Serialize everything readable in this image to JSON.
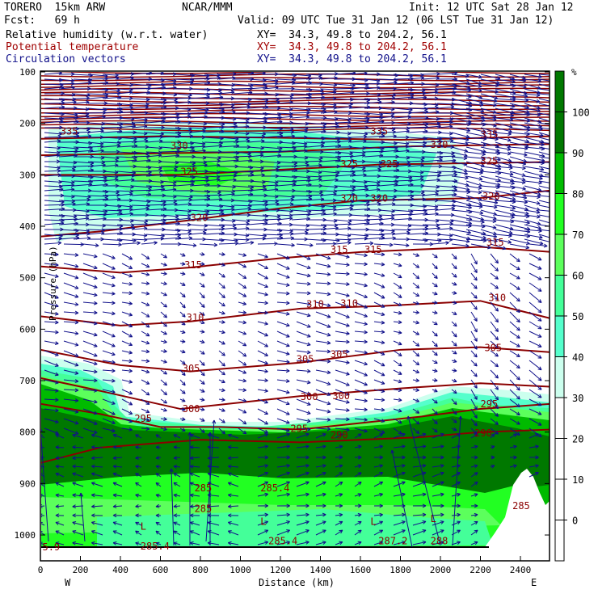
{
  "header": {
    "model": "TORERO  15km ARW",
    "org": "NCAR/MMM",
    "init": "Init: 12 UTC Sat 28 Jan 12",
    "fcst": "Fcst:   69 h",
    "valid": "Valid: 09 UTC Tue 31 Jan 12 (06 LST Tue 31 Jan 12)",
    "fields": [
      {
        "name": "Relative humidity (w.r.t. water)",
        "xy": "XY=  34.3, 49.8 to 204.2, 56.1",
        "color": "#000000"
      },
      {
        "name": "Potential temperature",
        "xy": "XY=  34.3, 49.8 to 204.2, 56.1",
        "color": "#a00000"
      },
      {
        "name": "Circulation vectors",
        "xy": "XY=  34.3, 49.8 to 204.2, 56.1",
        "color": "#10108a"
      }
    ]
  },
  "chart_data": {
    "type": "heatmap",
    "title": "Cross section: relative humidity, potential temperature, circulation vectors",
    "xlabel": "Distance (km)",
    "ylabel": "Pressure (hPa)",
    "x_ticks": [
      0,
      200,
      400,
      600,
      800,
      1000,
      1200,
      1400,
      1600,
      1800,
      2000,
      2200,
      2400
    ],
    "y_ticks": [
      100,
      200,
      300,
      400,
      500,
      600,
      700,
      800,
      900,
      1000
    ],
    "xlim": [
      0,
      2560
    ],
    "ylim": [
      1050,
      100
    ],
    "x_end_labels": {
      "left": "W",
      "right": "E"
    },
    "colorbar": {
      "unit": "%",
      "ticks": [
        100,
        90,
        80,
        70,
        60,
        50,
        40,
        30,
        20,
        10,
        0
      ],
      "levels": [
        {
          "range": ">100",
          "color": "#007800"
        },
        {
          "range": "90-100",
          "color": "#007800"
        },
        {
          "range": "80-90",
          "color": "#00bb00"
        },
        {
          "range": "70-80",
          "color": "#22ff22"
        },
        {
          "range": "60-70",
          "color": "#5cff5c"
        },
        {
          "range": "50-60",
          "color": "#44ff99"
        },
        {
          "range": "40-50",
          "color": "#55ffcc"
        },
        {
          "range": "30-40",
          "color": "#ccffee"
        },
        {
          "range": "20-30",
          "color": "#ffffff"
        },
        {
          "range": "10-20",
          "color": "#ffffff"
        },
        {
          "range": "0-10",
          "color": "#ffffff"
        },
        {
          "range": "<0",
          "color": "#ffffff"
        }
      ]
    },
    "theta_contours": [
      {
        "value": 335,
        "points": [
          [
            0,
            230
          ],
          [
            600,
            225
          ],
          [
            1200,
            228
          ],
          [
            1800,
            232
          ],
          [
            2560,
            225
          ]
        ]
      },
      {
        "value": 330,
        "points": [
          [
            0,
            262
          ],
          [
            600,
            258
          ],
          [
            1200,
            255
          ],
          [
            1800,
            245
          ],
          [
            2560,
            240
          ]
        ]
      },
      {
        "value": 325,
        "points": [
          [
            0,
            300
          ],
          [
            700,
            300
          ],
          [
            1200,
            290
          ],
          [
            1700,
            280
          ],
          [
            2560,
            275
          ]
        ]
      },
      {
        "value": 320,
        "points": [
          [
            0,
            420
          ],
          [
            300,
            410
          ],
          [
            750,
            388
          ],
          [
            1200,
            365
          ],
          [
            1600,
            350
          ],
          [
            2200,
            345
          ],
          [
            2560,
            330
          ]
        ]
      },
      {
        "value": 315,
        "points": [
          [
            0,
            478
          ],
          [
            400,
            490
          ],
          [
            750,
            480
          ],
          [
            1200,
            462
          ],
          [
            1600,
            450
          ],
          [
            2200,
            440
          ],
          [
            2560,
            450
          ]
        ]
      },
      {
        "value": 310,
        "points": [
          [
            0,
            575
          ],
          [
            400,
            593
          ],
          [
            750,
            585
          ],
          [
            1300,
            560
          ],
          [
            1700,
            555
          ],
          [
            2200,
            545
          ],
          [
            2560,
            580
          ]
        ]
      },
      {
        "value": 305,
        "points": [
          [
            0,
            640
          ],
          [
            400,
            670
          ],
          [
            750,
            682
          ],
          [
            1300,
            665
          ],
          [
            1800,
            640
          ],
          [
            2200,
            635
          ],
          [
            2560,
            645
          ]
        ]
      },
      {
        "value": 300,
        "points": [
          [
            0,
            695
          ],
          [
            300,
            720
          ],
          [
            700,
            755
          ],
          [
            1300,
            730
          ],
          [
            1800,
            715
          ],
          [
            2200,
            705
          ],
          [
            2560,
            712
          ]
        ]
      },
      {
        "value": 295,
        "points": [
          [
            0,
            745
          ],
          [
            300,
            765
          ],
          [
            600,
            790
          ],
          [
            900,
            790
          ],
          [
            1300,
            795
          ],
          [
            1900,
            770
          ],
          [
            2200,
            755
          ],
          [
            2560,
            745
          ]
        ]
      },
      {
        "value": 290,
        "points": [
          [
            0,
            860
          ],
          [
            300,
            830
          ],
          [
            800,
            815
          ],
          [
            1300,
            820
          ],
          [
            1900,
            810
          ],
          [
            2200,
            800
          ],
          [
            2560,
            795
          ]
        ]
      }
    ],
    "contour_labels": [
      {
        "text": "335",
        "km": 100,
        "hPa": 222
      },
      {
        "text": "335",
        "km": 1650,
        "hPa": 222
      },
      {
        "text": "335",
        "km": 2200,
        "hPa": 228
      },
      {
        "text": "330",
        "km": 650,
        "hPa": 250
      },
      {
        "text": "330",
        "km": 1950,
        "hPa": 248
      },
      {
        "text": "325",
        "km": 700,
        "hPa": 300
      },
      {
        "text": "325",
        "km": 1500,
        "hPa": 285
      },
      {
        "text": "325",
        "km": 1700,
        "hPa": 285
      },
      {
        "text": "325",
        "km": 2200,
        "hPa": 280
      },
      {
        "text": "320",
        "km": 750,
        "hPa": 390
      },
      {
        "text": "320",
        "km": 1500,
        "hPa": 352
      },
      {
        "text": "320",
        "km": 1650,
        "hPa": 352
      },
      {
        "text": "320",
        "km": 2210,
        "hPa": 348
      },
      {
        "text": "315",
        "km": 720,
        "hPa": 482
      },
      {
        "text": "315",
        "km": 1450,
        "hPa": 452
      },
      {
        "text": "315",
        "km": 1620,
        "hPa": 452
      },
      {
        "text": "315",
        "km": 2230,
        "hPa": 438
      },
      {
        "text": "310",
        "km": 730,
        "hPa": 584
      },
      {
        "text": "310",
        "km": 1330,
        "hPa": 558
      },
      {
        "text": "310",
        "km": 1500,
        "hPa": 556
      },
      {
        "text": "310",
        "km": 2240,
        "hPa": 545
      },
      {
        "text": "305",
        "km": 710,
        "hPa": 683
      },
      {
        "text": "305",
        "km": 1280,
        "hPa": 665
      },
      {
        "text": "305",
        "km": 1450,
        "hPa": 655
      },
      {
        "text": "305",
        "km": 2220,
        "hPa": 643
      },
      {
        "text": "300",
        "km": 710,
        "hPa": 761
      },
      {
        "text": "300",
        "km": 1300,
        "hPa": 738
      },
      {
        "text": "300",
        "km": 1460,
        "hPa": 736
      },
      {
        "text": "295",
        "km": 470,
        "hPa": 780
      },
      {
        "text": "295",
        "km": 1250,
        "hPa": 800
      },
      {
        "text": "295",
        "km": 2200,
        "hPa": 752
      },
      {
        "text": "290",
        "km": 1450,
        "hPa": 812
      },
      {
        "text": "290",
        "km": 2170,
        "hPa": 808
      },
      {
        "text": "285",
        "km": 770,
        "hPa": 915
      },
      {
        "text": "285",
        "km": 770,
        "hPa": 955
      },
      {
        "text": "285.4",
        "km": 1100,
        "hPa": 915
      },
      {
        "text": "285",
        "km": 2360,
        "hPa": 950
      },
      {
        "text": "285.4",
        "km": 500,
        "hPa": 1028
      },
      {
        "text": "285.4",
        "km": 1140,
        "hPa": 1018
      },
      {
        "text": "287.2",
        "km": 1690,
        "hPa": 1018
      },
      {
        "text": "288",
        "km": 1950,
        "hPa": 1018
      },
      {
        "text": "5.9",
        "km": 10,
        "hPa": 1030
      },
      {
        "text": "L",
        "km": 500,
        "hPa": 990
      },
      {
        "text": "L",
        "km": 1100,
        "hPa": 980
      },
      {
        "text": "L",
        "km": 1650,
        "hPa": 980
      },
      {
        "text": "L",
        "km": 1950,
        "hPa": 975
      }
    ]
  }
}
